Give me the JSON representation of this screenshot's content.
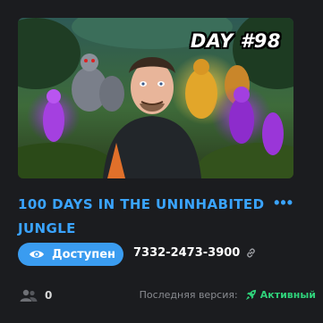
{
  "card": {
    "thumbnail": {
      "overlay_text": "DAY #98"
    },
    "title": "100 DAYS IN THE UNINHABITED JUNGLE",
    "more_label": "•••",
    "status": {
      "label": "Доступен",
      "color": "#3a9cf0"
    },
    "code": "7332-2473-3900",
    "players_count": "0",
    "version": {
      "label": "Последняя версия:",
      "status": "Активный",
      "status_color": "#2fd17a"
    },
    "icons": {
      "status": "eye-icon",
      "code": "link-icon",
      "players": "users-icon",
      "version": "rocket-icon",
      "more": "ellipsis-icon"
    }
  }
}
